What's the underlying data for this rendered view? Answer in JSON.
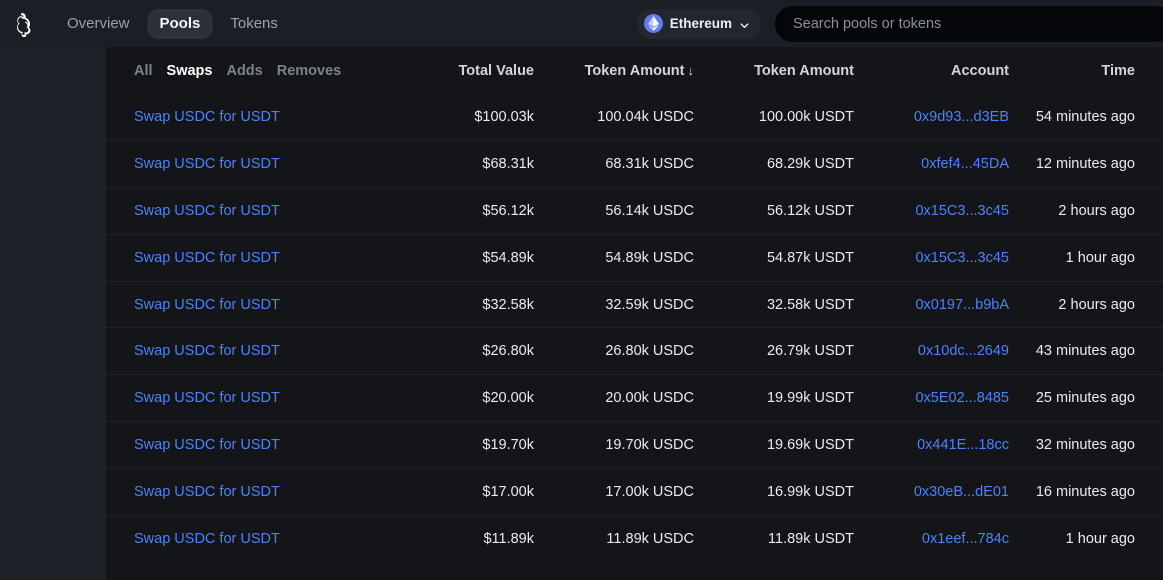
{
  "header": {
    "logo_icon": "uniswap-unicorn-logo",
    "nav": [
      {
        "label": "Overview",
        "active": false
      },
      {
        "label": "Pools",
        "active": true
      },
      {
        "label": "Tokens",
        "active": false
      }
    ],
    "chain_selector": {
      "label": "Ethereum",
      "icon": "ethereum-logo",
      "chevron_icon": "chevron-down-icon",
      "accent_color": "#627eea"
    },
    "search": {
      "placeholder": "Search pools or tokens",
      "value": ""
    }
  },
  "table": {
    "filters": [
      {
        "label": "All",
        "active": false
      },
      {
        "label": "Swaps",
        "active": true
      },
      {
        "label": "Adds",
        "active": false
      },
      {
        "label": "Removes",
        "active": false
      }
    ],
    "columns": [
      {
        "key": "type",
        "label": ""
      },
      {
        "key": "total",
        "label": "Total Value"
      },
      {
        "key": "tok0",
        "label": "Token Amount",
        "sorted": true,
        "sort_icon": "↓"
      },
      {
        "key": "tok1",
        "label": "Token Amount"
      },
      {
        "key": "acct",
        "label": "Account"
      },
      {
        "key": "time",
        "label": "Time"
      }
    ],
    "link_color": "#4c82fb",
    "rows": [
      {
        "type": "Swap USDC for USDT",
        "total": "$100.03k",
        "tok0": "100.04k USDC",
        "tok1": "100.00k USDT",
        "acct": "0x9d93...d3EB",
        "time": "54 minutes ago"
      },
      {
        "type": "Swap USDC for USDT",
        "total": "$68.31k",
        "tok0": "68.31k USDC",
        "tok1": "68.29k USDT",
        "acct": "0xfef4...45DA",
        "time": "12 minutes ago"
      },
      {
        "type": "Swap USDC for USDT",
        "total": "$56.12k",
        "tok0": "56.14k USDC",
        "tok1": "56.12k USDT",
        "acct": "0x15C3...3c45",
        "time": "2 hours ago"
      },
      {
        "type": "Swap USDC for USDT",
        "total": "$54.89k",
        "tok0": "54.89k USDC",
        "tok1": "54.87k USDT",
        "acct": "0x15C3...3c45",
        "time": "1 hour ago"
      },
      {
        "type": "Swap USDC for USDT",
        "total": "$32.58k",
        "tok0": "32.59k USDC",
        "tok1": "32.58k USDT",
        "acct": "0x0197...b9bA",
        "time": "2 hours ago"
      },
      {
        "type": "Swap USDC for USDT",
        "total": "$26.80k",
        "tok0": "26.80k USDC",
        "tok1": "26.79k USDT",
        "acct": "0x10dc...2649",
        "time": "43 minutes ago"
      },
      {
        "type": "Swap USDC for USDT",
        "total": "$20.00k",
        "tok0": "20.00k USDC",
        "tok1": "19.99k USDT",
        "acct": "0x5E02...8485",
        "time": "25 minutes ago"
      },
      {
        "type": "Swap USDC for USDT",
        "total": "$19.70k",
        "tok0": "19.70k USDC",
        "tok1": "19.69k USDT",
        "acct": "0x441E...18cc",
        "time": "32 minutes ago"
      },
      {
        "type": "Swap USDC for USDT",
        "total": "$17.00k",
        "tok0": "17.00k USDC",
        "tok1": "16.99k USDT",
        "acct": "0x30eB...dE01",
        "time": "16 minutes ago"
      },
      {
        "type": "Swap USDC for USDT",
        "total": "$11.89k",
        "tok0": "11.89k USDC",
        "tok1": "11.89k USDT",
        "acct": "0x1eef...784c",
        "time": "1 hour ago"
      }
    ]
  }
}
